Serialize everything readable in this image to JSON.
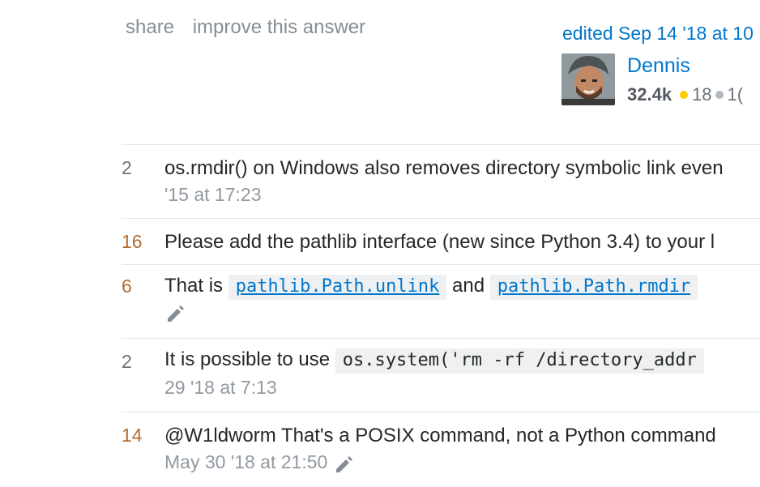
{
  "post_menu": {
    "share_label": "share",
    "improve_label": "improve this answer"
  },
  "edit_info": {
    "edited_label": "edited Sep 14 '18 at 10"
  },
  "user": {
    "name": "Dennis",
    "reputation": "32.4k",
    "gold_badges": "18",
    "silver_badges": "1("
  },
  "comments": [
    {
      "score": "2",
      "text": "os.rmdir() on Windows also removes directory symbolic link even",
      "date": "'15 at 17:23"
    },
    {
      "score": "16",
      "text": "Please add the pathlib interface (new since Python 3.4) to your l"
    },
    {
      "score": "6",
      "prefix": "That is",
      "code1": "pathlib.Path.unlink",
      "middle": "and",
      "code2": "pathlib.Path.rmdir"
    },
    {
      "score": "2",
      "prefix": "It is possible to use",
      "code": "os.system('rm -rf /directory_addr",
      "date": "29 '18 at 7:13"
    },
    {
      "score": "14",
      "text": "@W1ldworm That's a POSIX command, not a Python command",
      "date": "May 30 '18 at 21:50"
    }
  ],
  "colors": {
    "link": "#0077cc",
    "hot_score": "#b46c2f",
    "muted": "#9199a1"
  }
}
